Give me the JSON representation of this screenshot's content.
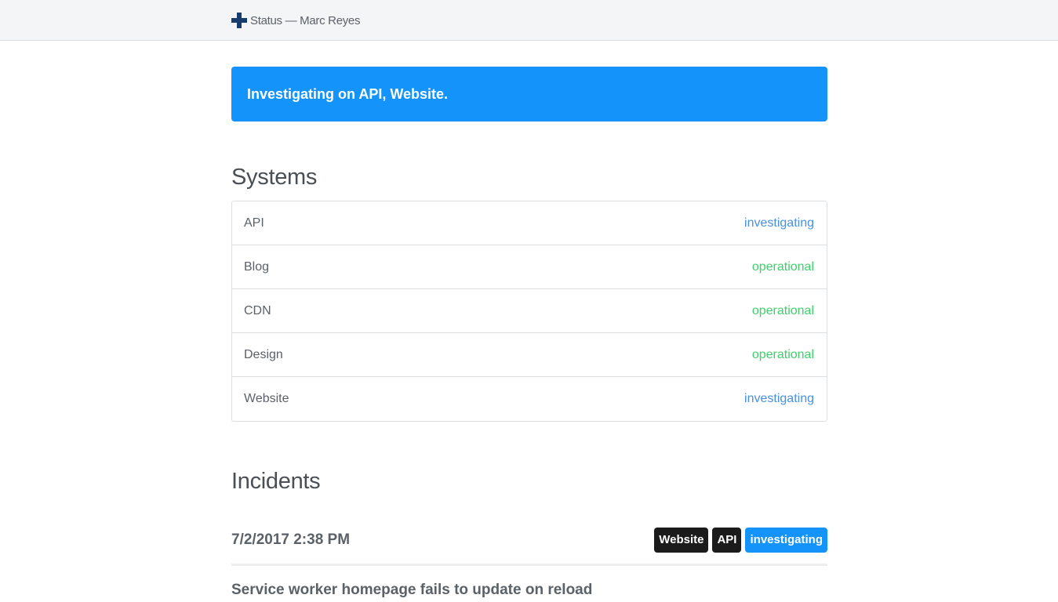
{
  "header": {
    "brand_icon": "plus-cross-icon",
    "brand_text": "Status — Marc Reyes"
  },
  "alert": {
    "text": "Investigating on API, Website.",
    "color": "#1493fa"
  },
  "systems": {
    "title": "Systems",
    "items": [
      {
        "name": "API",
        "status": "investigating"
      },
      {
        "name": "Blog",
        "status": "operational"
      },
      {
        "name": "CDN",
        "status": "operational"
      },
      {
        "name": "Design",
        "status": "operational"
      },
      {
        "name": "Website",
        "status": "investigating"
      }
    ],
    "status_colors": {
      "investigating": "#4a8fe0",
      "operational": "#3fcf6a"
    }
  },
  "incidents": {
    "title": "Incidents",
    "items": [
      {
        "date": "7/2/2017 2:38 PM",
        "tags": [
          "Website",
          "API"
        ],
        "status_tag": "investigating",
        "title": "Service worker homepage fails to update on reload"
      }
    ]
  }
}
